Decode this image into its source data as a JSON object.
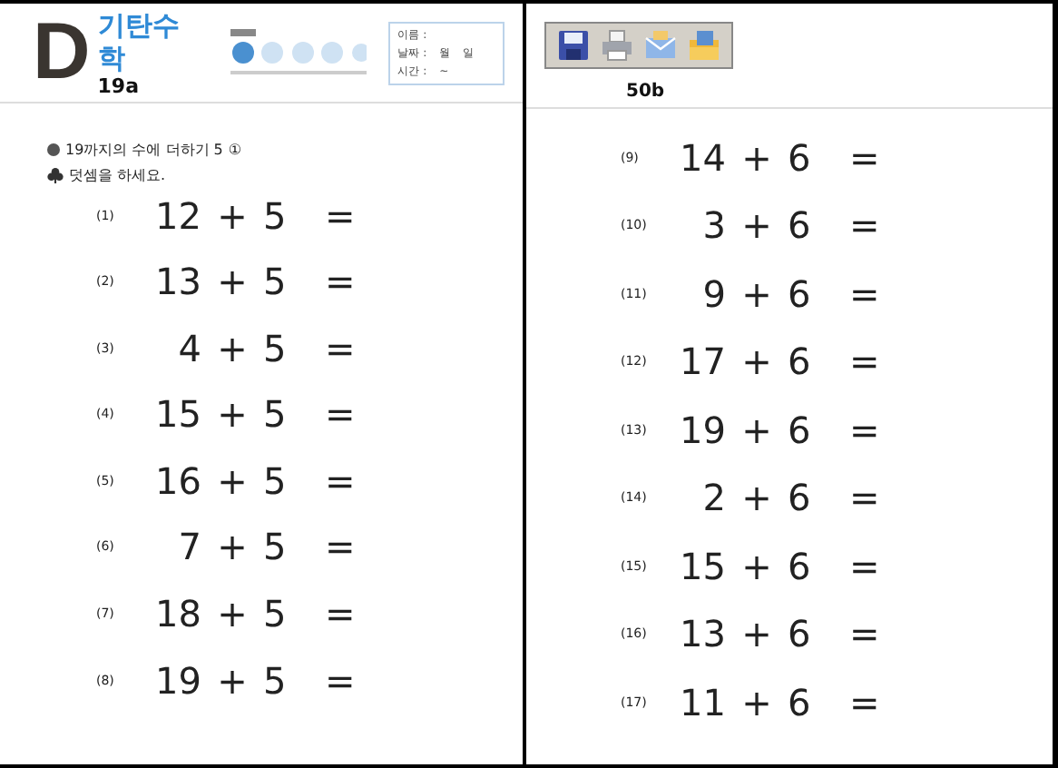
{
  "left_page": {
    "logo": {
      "letter": "D",
      "title": "기탄수학",
      "code": "19a"
    },
    "info_rows": [
      {
        "items": [
          "이름 :"
        ]
      },
      {
        "items": [
          "날짜 :",
          "월",
          "일"
        ]
      },
      {
        "items": [
          "시간 :",
          "~"
        ]
      }
    ],
    "section_title": "19까지의 수에 더하기 5",
    "section_mark": "①",
    "instruction": "덧셈을 하세요.",
    "problems": [
      {
        "number": "(1)",
        "a": "12",
        "op": "+",
        "b": "5",
        "eq": "="
      },
      {
        "number": "(2)",
        "a": "13",
        "op": "+",
        "b": "5",
        "eq": "="
      },
      {
        "number": "(3)",
        "a": "4",
        "op": "+",
        "b": "5",
        "eq": "="
      },
      {
        "number": "(4)",
        "a": "15",
        "op": "+",
        "b": "5",
        "eq": "="
      },
      {
        "number": "(5)",
        "a": "16",
        "op": "+",
        "b": "5",
        "eq": "="
      },
      {
        "number": "(6)",
        "a": "7",
        "op": "+",
        "b": "5",
        "eq": "="
      },
      {
        "number": "(7)",
        "a": "18",
        "op": "+",
        "b": "5",
        "eq": "="
      },
      {
        "number": "(8)",
        "a": "19",
        "op": "+",
        "b": "5",
        "eq": "="
      }
    ]
  },
  "right_page": {
    "code": "50b",
    "problems": [
      {
        "number": "(9)",
        "a": "14",
        "op": "+",
        "b": "6",
        "eq": "="
      },
      {
        "number": "(10)",
        "a": "3",
        "op": "+",
        "b": "6",
        "eq": "="
      },
      {
        "number": "(11)",
        "a": "9",
        "op": "+",
        "b": "6",
        "eq": "="
      },
      {
        "number": "(12)",
        "a": "17",
        "op": "+",
        "b": "6",
        "eq": "="
      },
      {
        "number": "(13)",
        "a": "19",
        "op": "+",
        "b": "6",
        "eq": "="
      },
      {
        "number": "(14)",
        "a": "2",
        "op": "+",
        "b": "6",
        "eq": "="
      },
      {
        "number": "(15)",
        "a": "15",
        "op": "+",
        "b": "6",
        "eq": "="
      },
      {
        "number": "(16)",
        "a": "13",
        "op": "+",
        "b": "6",
        "eq": "="
      },
      {
        "number": "(17)",
        "a": "11",
        "op": "+",
        "b": "6",
        "eq": "="
      }
    ]
  },
  "toolbar": {
    "buttons": [
      {
        "kind": "save"
      },
      {
        "kind": "print"
      },
      {
        "kind": "mail"
      },
      {
        "kind": "export"
      }
    ]
  }
}
